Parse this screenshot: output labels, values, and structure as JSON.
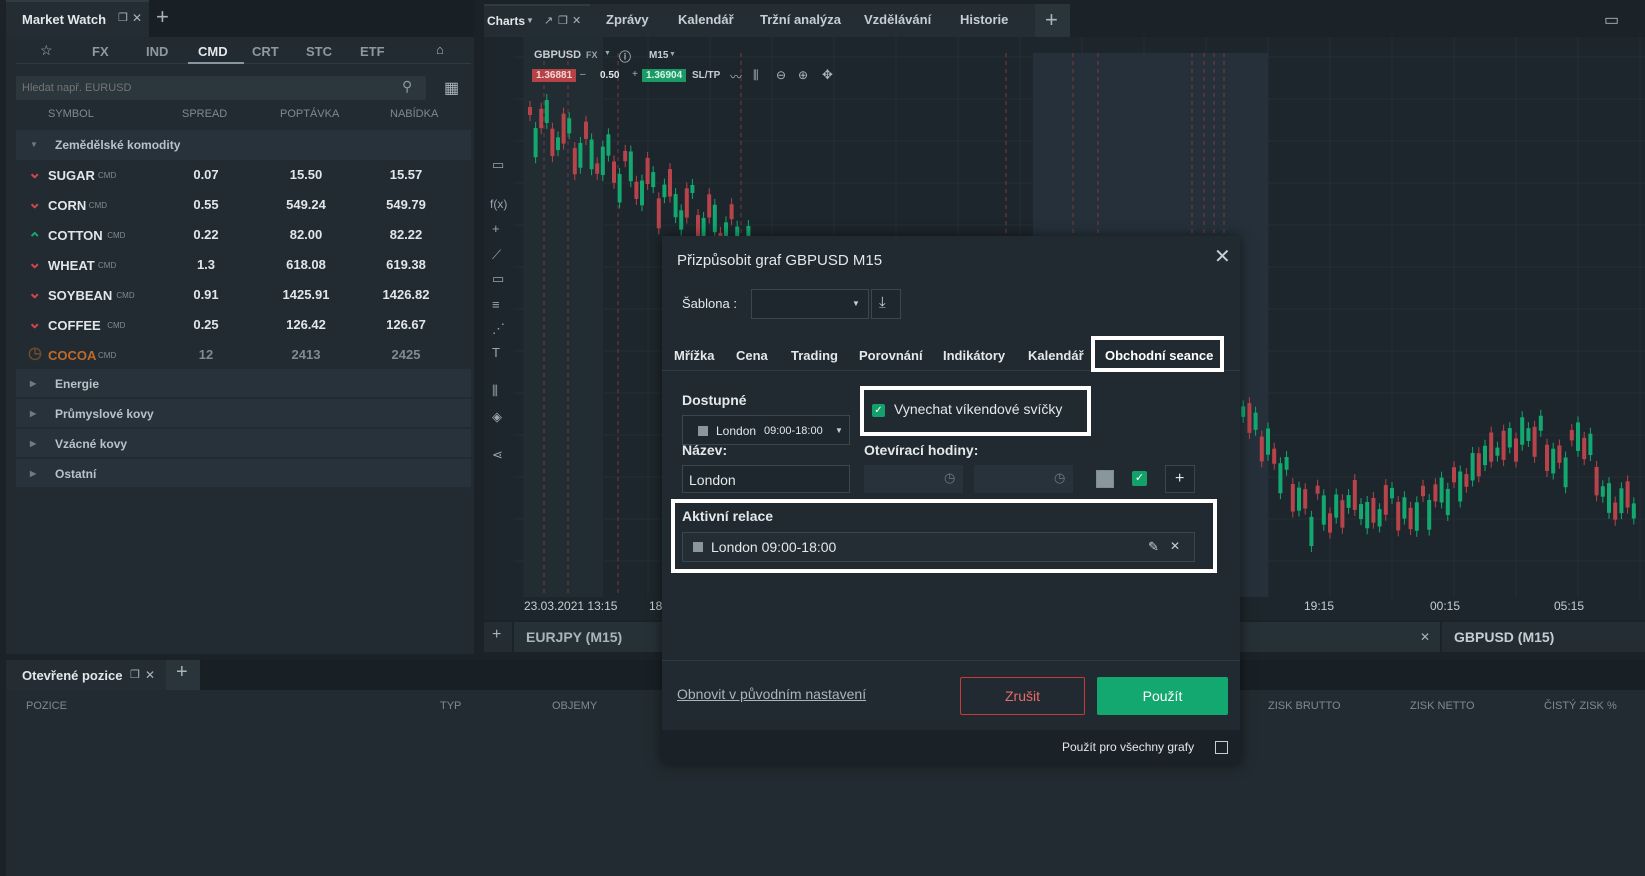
{
  "market_watch": {
    "title": "Market Watch",
    "tabs": [
      "FX",
      "IND",
      "CMD",
      "CRT",
      "STC",
      "ETF"
    ],
    "search_placeholder": "Hledat např. EURUSD",
    "columns": [
      "SYMBOL",
      "SPREAD",
      "POPTÁVKA",
      "NABÍDKA"
    ],
    "group_open": "Zemědělské komodity",
    "rows": [
      {
        "symbol": "SUGAR",
        "tag": "CMD",
        "spread": "0.07",
        "bid": "15.50",
        "ask": "15.57",
        "dir": "down"
      },
      {
        "symbol": "CORN",
        "tag": "CMD",
        "spread": "0.55",
        "bid": "549.24",
        "ask": "549.79",
        "dir": "down"
      },
      {
        "symbol": "COTTON",
        "tag": "CMD",
        "spread": "0.22",
        "bid": "82.00",
        "ask": "82.22",
        "dir": "up"
      },
      {
        "symbol": "WHEAT",
        "tag": "CMD",
        "spread": "1.3",
        "bid": "618.08",
        "ask": "619.38",
        "dir": "down"
      },
      {
        "symbol": "SOYBEAN",
        "tag": "CMD",
        "spread": "0.91",
        "bid": "1425.91",
        "ask": "1426.82",
        "dir": "down"
      },
      {
        "symbol": "COFFEE",
        "tag": "CMD",
        "spread": "0.25",
        "bid": "126.42",
        "ask": "126.67",
        "dir": "down"
      },
      {
        "symbol": "COCOA",
        "tag": "CMD",
        "spread": "12",
        "bid": "2413",
        "ask": "2425",
        "dir": "closed"
      }
    ],
    "groups_closed": [
      "Energie",
      "Průmyslové kovy",
      "Vzácné kovy",
      "Ostatní"
    ]
  },
  "top_tabs": [
    "Charts",
    "Zprávy",
    "Kalendář",
    "Tržní analýza",
    "Vzdělávání",
    "Historie"
  ],
  "chart": {
    "symbol": "GBPUSD",
    "market": "FX",
    "timeframe": "M15",
    "bid": "1.36881",
    "spread": "0.50",
    "ask": "1.36904",
    "sltp": "SL/TP",
    "time_labels": [
      "23.03.2021 13:15",
      "18",
      "19:15",
      "00:15",
      "05:15"
    ],
    "bottom_tabs": [
      "EURJPY (M15)",
      "GBPUSD (M15)"
    ]
  },
  "positions": {
    "title": "Otevřené pozice",
    "columns": [
      "POZICE",
      "TYP",
      "OBJEMY",
      "ZISK BRUTTO",
      "ZISK NETTO",
      "ČISTÝ ZISK %"
    ]
  },
  "dialog": {
    "title": "Přizpůsobit graf GBPUSD M15",
    "template_label": "Šablona :",
    "tabs": [
      "Mřížka",
      "Cena",
      "Trading",
      "Porovnání",
      "Indikátory",
      "Kalendář",
      "Obchodní seance"
    ],
    "available_label": "Dostupné",
    "available_value": "London",
    "available_hours": "09:00-18:00",
    "skip_weekend": "Vynechat víkendové svíčky",
    "name_label": "Název:",
    "name_value": "London",
    "opening_label": "Otevírací hodiny:",
    "active_label": "Aktivní relace",
    "active_session": "London 09:00-18:00",
    "reset": "Obnovit v původním nastavení",
    "cancel": "Zrušit",
    "apply": "Použít",
    "apply_all": "Použít pro všechny grafy"
  },
  "colors": {
    "green": "#12a86f",
    "red": "#d14848",
    "bg": "#1b2329",
    "panel": "#232d33"
  }
}
